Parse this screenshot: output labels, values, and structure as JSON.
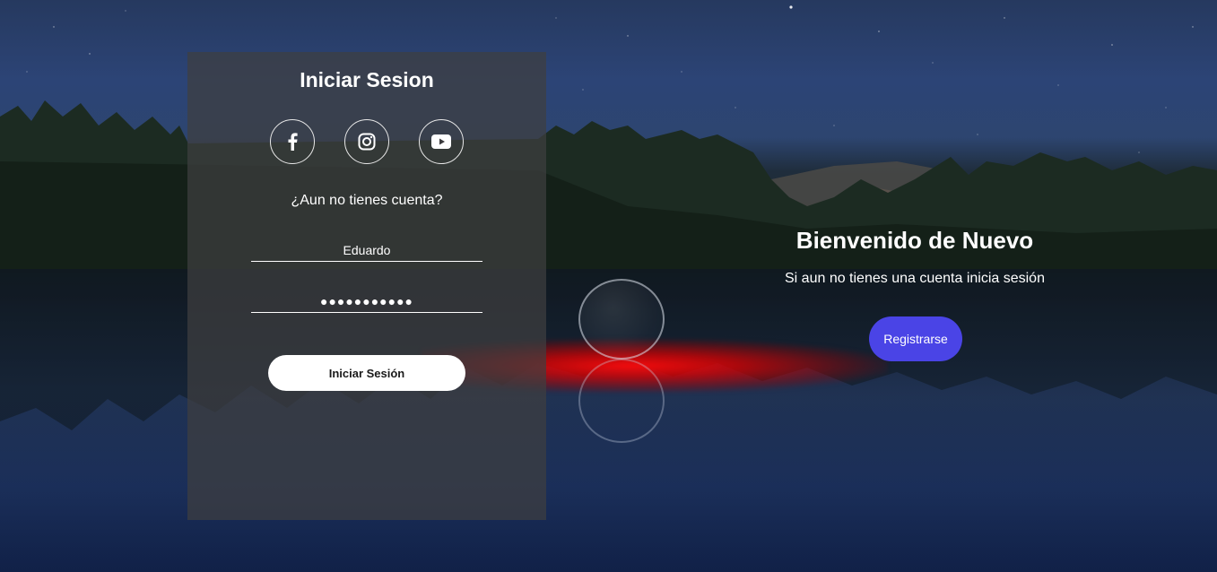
{
  "login": {
    "title": "Iniciar Sesion",
    "question": "¿Aun no tienes cuenta?",
    "username_value": "Eduardo",
    "password_value": "●●●●●●●●●●●",
    "submit_label": "Iniciar Sesión",
    "social": [
      "facebook-icon",
      "instagram-icon",
      "youtube-icon"
    ]
  },
  "welcome": {
    "title": "Bienvenido de Nuevo",
    "subtitle": "Si aun no tienes una cuenta inicia sesión",
    "register_label": "Registrarse"
  },
  "colors": {
    "accent": "#4a44e6",
    "panel": "#3e3e40",
    "glow": "#ff0a0a"
  }
}
